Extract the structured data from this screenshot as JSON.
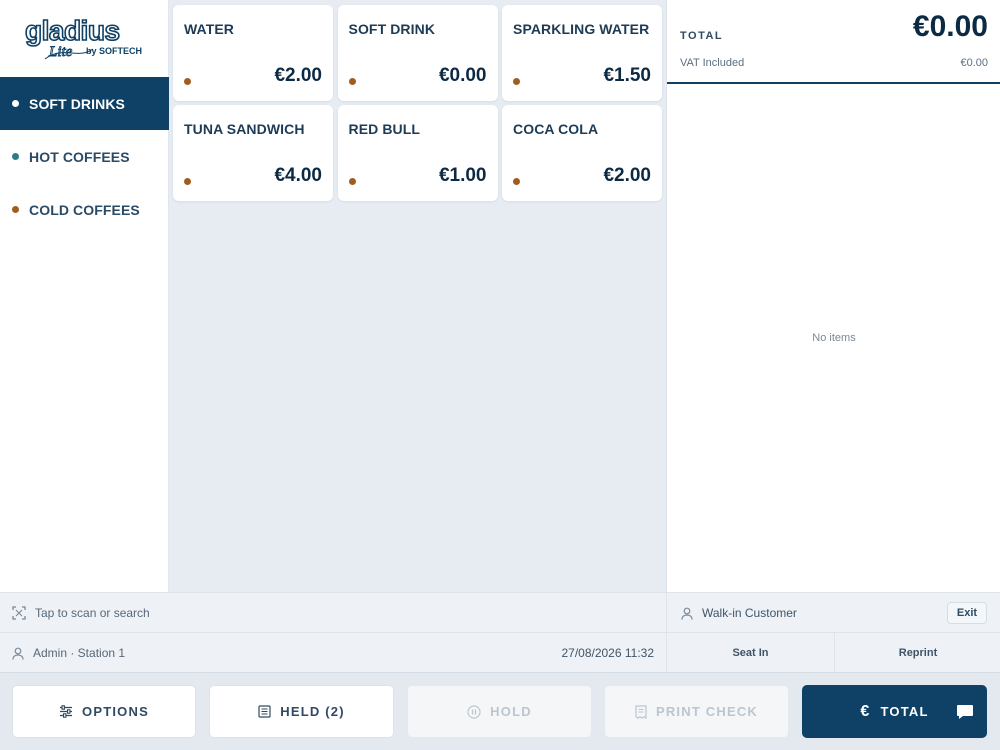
{
  "logo": {
    "brand": "gladius",
    "sub": "Lite",
    "by": "by SOFTECH"
  },
  "categories": [
    {
      "label": "SOFT DRINKS",
      "color": "#ffffff",
      "active": true
    },
    {
      "label": "HOT COFFEES",
      "color": "#2a7c86",
      "active": false
    },
    {
      "label": "COLD COFFEES",
      "color": "#a15d20",
      "active": false
    }
  ],
  "products": [
    {
      "name": "WATER",
      "price": "€2.00",
      "color": "#a15d20"
    },
    {
      "name": "SOFT DRINK",
      "price": "€0.00",
      "color": "#a15d20"
    },
    {
      "name": "SPARKLING WATER",
      "price": "€1.50",
      "color": "#a15d20"
    },
    {
      "name": "TUNA SANDWICH",
      "price": "€4.00",
      "color": "#a15d20"
    },
    {
      "name": "RED BULL",
      "price": "€1.00",
      "color": "#a15d20"
    },
    {
      "name": "COCA COLA",
      "price": "€2.00",
      "color": "#a15d20"
    }
  ],
  "order": {
    "total_label": "TOTAL",
    "total_amount": "€0.00",
    "vat_label": "VAT Included",
    "vat_amount": "€0.00",
    "empty_text": "No items"
  },
  "scan": {
    "placeholder": "Tap to scan or search"
  },
  "customer": {
    "name": "Walk-in Customer",
    "exit_label": "Exit"
  },
  "session": {
    "user": "Admin · Station 1",
    "datetime": "27/08/2026 11:32"
  },
  "order_actions": {
    "seat_in": "Seat In",
    "reprint": "Reprint"
  },
  "actions": {
    "options": "OPTIONS",
    "held": "HELD (2)",
    "hold": "HOLD",
    "print_check": "PRINT CHECK",
    "total": "TOTAL"
  },
  "icons": {
    "options": "sliders-icon",
    "held": "list-icon",
    "hold": "pause-icon",
    "print": "receipt-icon",
    "total": "euro-icon",
    "chat": "chat-icon",
    "scan": "scan-icon",
    "user": "user-icon"
  },
  "colors": {
    "brand": "#0f4066",
    "accent_dot": "#a15d20",
    "teal_dot": "#2a7c86"
  }
}
